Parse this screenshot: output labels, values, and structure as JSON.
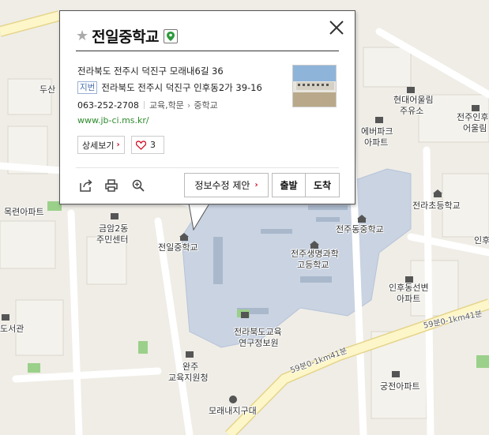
{
  "popup": {
    "title": "전일중학교",
    "address_road": "전라북도 전주시 덕진구 모래내6길 36",
    "jibun_tag": "지번",
    "address_jibun": "전라북도 전주시 덕진구 인후동2가 39-16",
    "phone": "063-252-2708",
    "category_parent": "교육,학문",
    "category_child": "중학교",
    "url": "www.jb-ci.ms.kr/",
    "detail_label": "상세보기",
    "like_count": "3",
    "suggest_edit_label": "정보수정 제안",
    "depart_label": "출발",
    "arrive_label": "도착"
  },
  "map_labels": {
    "jeonil": "전일중학교",
    "jeonju_dong": "전주동중학교",
    "saengmyeong_1": "전주생명과학",
    "saengmyeong_2": "고등학교",
    "jeolla_elem": "전라초등학교",
    "mokgeon": "목련아파트",
    "geumam_1": "금암2동",
    "geumam_2": "주민센터",
    "hyundai_1": "현대어울림",
    "hyundai_2": "주유소",
    "everpark_1": "에버파크",
    "everpark_2": "아파트",
    "jeonju_in_1": "전주인후",
    "jeonju_in_2": "어울림",
    "inhu_seonbyeon_1": "인후동선변",
    "inhu_seonbyeon_2": "아파트",
    "edu_1": "전라북도교육",
    "edu_2": "연구정보원",
    "wanju_1": "완주",
    "wanju_2": "교육지원청",
    "moraenae": "모래내지구대",
    "gunggeon": "궁전아파트",
    "library": "도서관",
    "dusan": "두산",
    "inhu_edge": "인후",
    "road_1": "59분0-1km41분",
    "road_2": "59분0-1km41분"
  },
  "colors": {
    "school_zone": "#c9d3e2",
    "road": "#ffffff",
    "main_road": "#fdf6c9",
    "green": "#9bd08a",
    "accent_red": "#d0021b",
    "url_green": "#2e8b2e"
  }
}
